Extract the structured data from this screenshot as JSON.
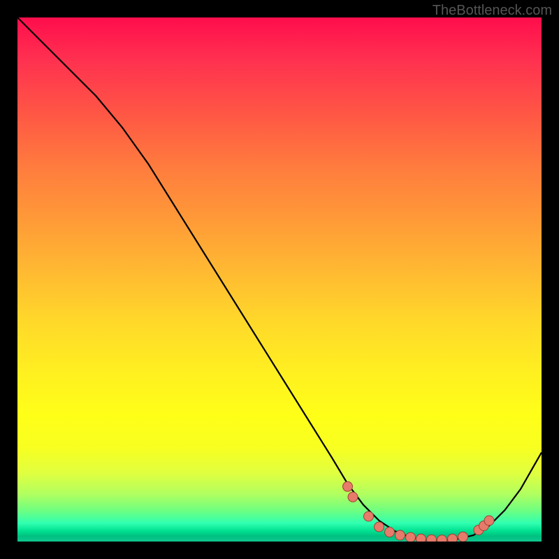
{
  "watermark": "TheBottleneck.com",
  "chart_data": {
    "type": "line",
    "title": "",
    "xlabel": "",
    "ylabel": "",
    "xlim": [
      0,
      100
    ],
    "ylim": [
      0,
      100
    ],
    "grid": false,
    "legend": false,
    "series": [
      {
        "name": "curve",
        "x": [
          0,
          5,
          10,
          15,
          20,
          25,
          30,
          35,
          40,
          45,
          50,
          55,
          60,
          63,
          66,
          69,
          72,
          75,
          78,
          81,
          84,
          87,
          90,
          93,
          96,
          100
        ],
        "y": [
          100,
          95,
          90,
          85,
          79,
          72,
          64,
          56,
          48,
          40,
          32,
          24,
          16,
          11,
          7,
          4,
          2,
          0.8,
          0.3,
          0.2,
          0.5,
          1.2,
          3,
          6,
          10,
          17
        ],
        "color": "#000000"
      }
    ],
    "markers": [
      {
        "x": 63,
        "y": 10.5
      },
      {
        "x": 64,
        "y": 8.5
      },
      {
        "x": 67,
        "y": 4.8
      },
      {
        "x": 69,
        "y": 2.8
      },
      {
        "x": 71,
        "y": 1.8
      },
      {
        "x": 73,
        "y": 1.2
      },
      {
        "x": 75,
        "y": 0.8
      },
      {
        "x": 77,
        "y": 0.5
      },
      {
        "x": 79,
        "y": 0.35
      },
      {
        "x": 81,
        "y": 0.3
      },
      {
        "x": 83,
        "y": 0.5
      },
      {
        "x": 85,
        "y": 0.9
      },
      {
        "x": 88,
        "y": 2.2
      },
      {
        "x": 89,
        "y": 3.0
      },
      {
        "x": 90,
        "y": 4.0
      }
    ],
    "marker_style": {
      "fill": "#e67b6c",
      "stroke": "#a04030",
      "r": 7
    }
  }
}
